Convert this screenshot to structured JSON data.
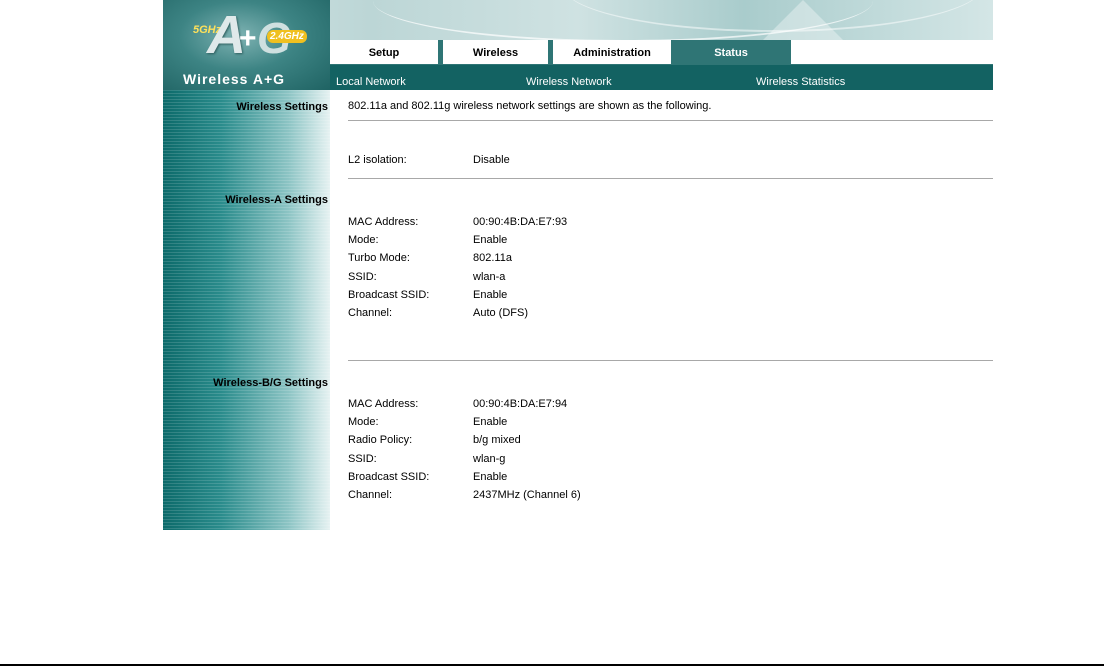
{
  "logo": {
    "badge_5ghz": "5GHz",
    "letter_a": "A",
    "plus": "+",
    "letter_g": "G",
    "badge_24ghz": "2.4GHz",
    "product_name": "Wireless A+G"
  },
  "tabs": [
    {
      "label": "Setup",
      "active": false
    },
    {
      "label": "Wireless",
      "active": false
    },
    {
      "label": "Administration",
      "active": false
    },
    {
      "label": "Status",
      "active": true
    }
  ],
  "subnav": {
    "items": [
      "Local Network",
      "Wireless Network",
      "Wireless Statistics"
    ]
  },
  "sections": {
    "wireless_settings": "Wireless Settings",
    "wireless_a": "Wireless-A Settings",
    "wireless_bg": "Wireless-B/G Settings"
  },
  "intro_text": "802.11a and 802.11g wireless network settings are shown as the following.",
  "l2": {
    "label": "L2 isolation:",
    "value": "Disable"
  },
  "wireless_a": [
    {
      "label": "MAC Address:",
      "value": "00:90:4B:DA:E7:93"
    },
    {
      "label": "Mode:",
      "value": "Enable"
    },
    {
      "label": "Turbo Mode:",
      "value": "802.11a"
    },
    {
      "label": "SSID:",
      "value": "wlan-a"
    },
    {
      "label": "Broadcast SSID:",
      "value": "Enable"
    },
    {
      "label": "Channel:",
      "value": "Auto (DFS)"
    }
  ],
  "wireless_bg": [
    {
      "label": "MAC Address:",
      "value": "00:90:4B:DA:E7:94"
    },
    {
      "label": "Mode:",
      "value": "Enable"
    },
    {
      "label": "Radio Policy:",
      "value": "b/g mixed"
    },
    {
      "label": "SSID:",
      "value": "wlan-g"
    },
    {
      "label": "Broadcast SSID:",
      "value": "Enable"
    },
    {
      "label": "Channel:",
      "value": "2437MHz (Channel 6)"
    }
  ],
  "colors": {
    "tab_bar": "#2f7575",
    "subnav": "#136262",
    "accent_yellow": "#f0c020"
  }
}
